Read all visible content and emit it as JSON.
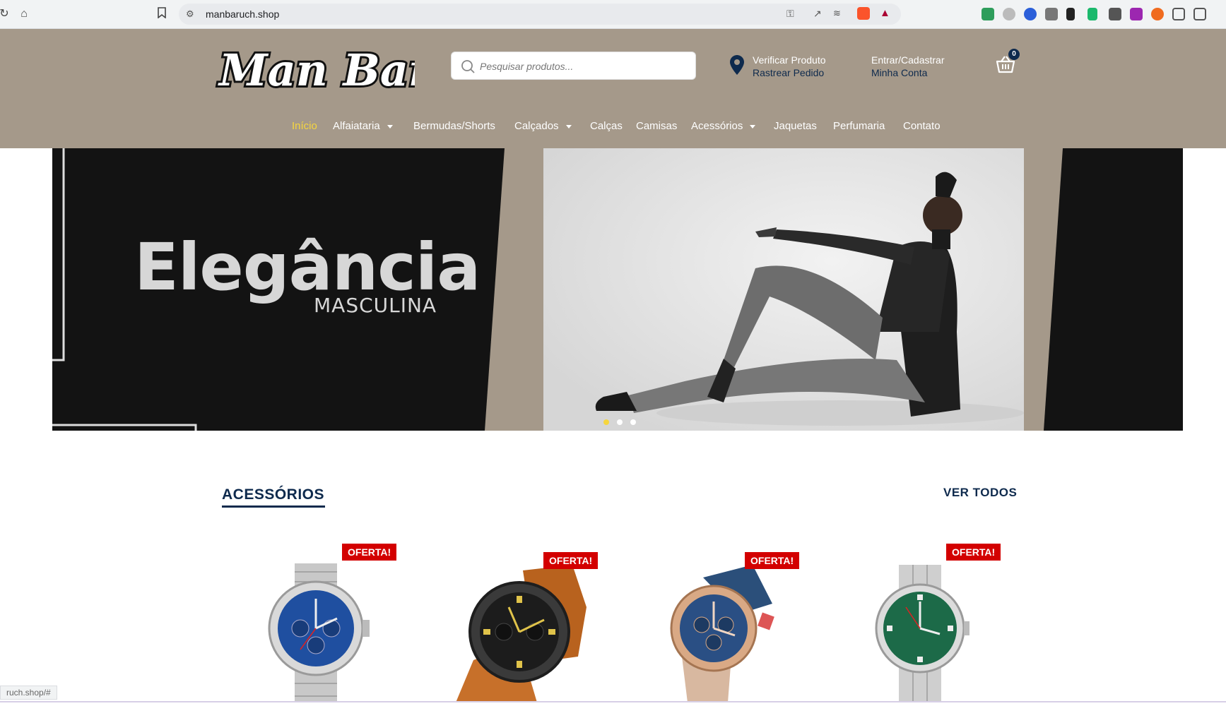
{
  "browser": {
    "url": "manbaruch.shop",
    "status_url": "ruch.shop/#"
  },
  "header": {
    "logo_text": "Man Baruch",
    "search": {
      "placeholder": "Pesquisar produtos..."
    },
    "track": {
      "line1": "Verificar Produto",
      "line2": "Rastrear Pedido"
    },
    "account": {
      "line1": "Entrar/Cadastrar",
      "line2": "Minha Conta"
    },
    "cart_count": "0"
  },
  "nav": {
    "items": [
      {
        "label": "Início",
        "active": true,
        "dropdown": false
      },
      {
        "label": "Alfaiataria",
        "dropdown": true
      },
      {
        "label": "Bermudas/Shorts",
        "dropdown": false
      },
      {
        "label": "Calçados",
        "dropdown": true
      },
      {
        "label": "Calças",
        "dropdown": false
      },
      {
        "label": "Camisas",
        "dropdown": false
      },
      {
        "label": "Acessórios",
        "dropdown": true
      },
      {
        "label": "Jaquetas",
        "dropdown": false
      },
      {
        "label": "Perfumaria",
        "dropdown": false
      },
      {
        "label": "Contato",
        "dropdown": false
      }
    ]
  },
  "hero": {
    "title": "Elegância",
    "subtitle": "MASCULINA",
    "slides": 3,
    "active_slide": 1
  },
  "section": {
    "title": "ACESSÓRIOS",
    "view_all": "VER TODOS",
    "products": [
      {
        "badge": "OFERTA!",
        "dial_color": "#1f4fa0",
        "strap": "steel"
      },
      {
        "badge": "OFERTA!",
        "dial_color": "#1c1c1c",
        "strap": "leather"
      },
      {
        "badge": "OFERTA!",
        "dial_color": "#2a4f84",
        "strap": "leather-blue"
      },
      {
        "badge": "OFERTA!",
        "dial_color": "#1c6a48",
        "strap": "steel"
      }
    ]
  },
  "colors": {
    "header_bg": "#a5998a",
    "navy": "#0e2a4d",
    "active_nav": "#f6d63e",
    "badge_red": "#d30000"
  }
}
